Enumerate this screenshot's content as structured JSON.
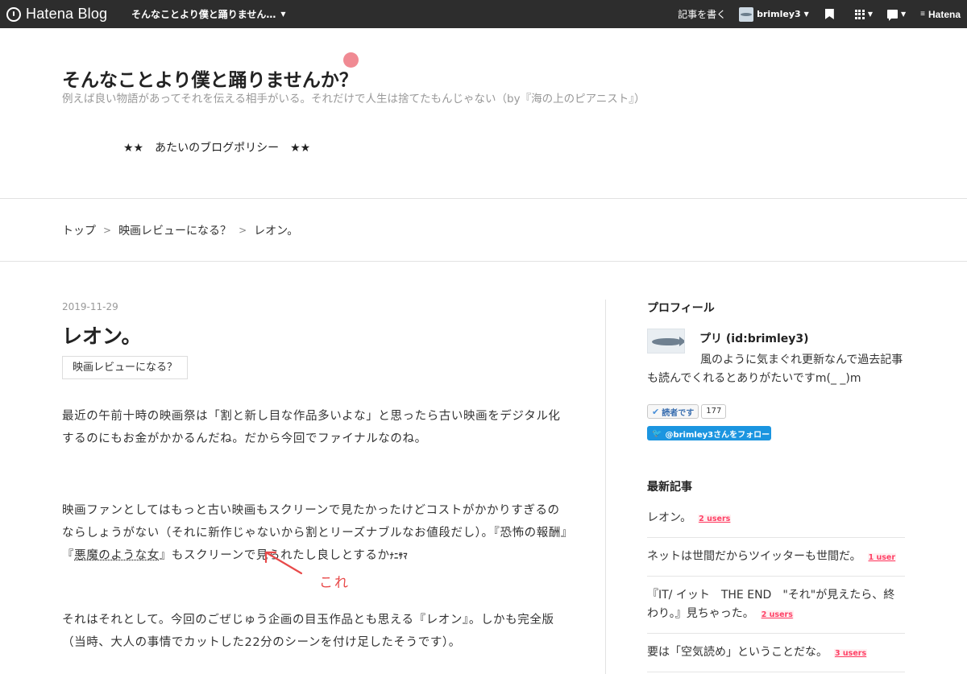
{
  "topbar": {
    "logo_text": "Hatena Blog",
    "blog_selector": "そんなことより僕と踊りません…",
    "write_link": "記事を書く",
    "username": "brimley3",
    "brand": "Hatena"
  },
  "header": {
    "title": "そんなことより僕と踊りませんか？",
    "description": "例えば良い物語があってそれを伝える相手がいる。それだけで人生は捨てたもんじゃない（by『海の上のピアニスト』）",
    "policy_link": "★★　あたいのブログポリシー　★★"
  },
  "breadcrumb": {
    "items": [
      "トップ",
      "映画レビューになる？",
      "レオン。"
    ],
    "separator": ">"
  },
  "entry": {
    "date": "2019-11-29",
    "title": "レオン。",
    "category": "映画レビューになる？",
    "p1": "最近の午前十時の映画祭は「割と新し目な作品多いよな」と思ったら古い映画をデジタル化するのにもお金がかかるんだね。だから今回でファイナルなのね。",
    "p2_a": "映画ファンとしてはもっと古い映画もスクリーンで見たかったけどコストがかかりすぎるのならしょうがない（それに新作じゃないから割とリーズナブルなお値段だし）。『恐怖の報酬』『",
    "p2_link": "悪魔のような女",
    "p2_b": "』もスクリーンで見られたし良しとするか",
    "p2_stamp": "ﾅﾆｻﾏ",
    "annotation": "これ",
    "p3": "それはそれとして。今回のごぜじゅう企画の目玉作品とも思える『レオン』。しかも完全版（当時、大人の事情でカットした22分のシーンを付け足したそうです）。"
  },
  "sidebar": {
    "profile_heading": "プロフィール",
    "profile_name": "プリ (id:brimley3)",
    "profile_desc": "風のように気まぐれ更新なんで過去記事も読んでくれるとありがたいですm(_ _)m",
    "subscribe_label": "読者です",
    "subscriber_count": "177",
    "follow_label": "@brimley3さんをフォロー",
    "recent_heading": "最新記事",
    "recent": [
      {
        "title": "レオン。",
        "users": "2 users"
      },
      {
        "title": "ネットは世間だからツイッターも世間だ。",
        "users": "1 user"
      },
      {
        "title": "『IT/ イット　THE END　\"それ\"が見えたら、終わり。』見ちゃった。",
        "users": "2 users"
      },
      {
        "title": "要は「空気読め」ということだな。",
        "users": "3 users"
      }
    ]
  },
  "colors": {
    "topbar_bg": "#2d2d2d",
    "accent_pink": "#f08a93",
    "annotation_red": "#e84a4a",
    "users_pink": "#ff4166",
    "twitter_blue": "#1b95e0"
  }
}
